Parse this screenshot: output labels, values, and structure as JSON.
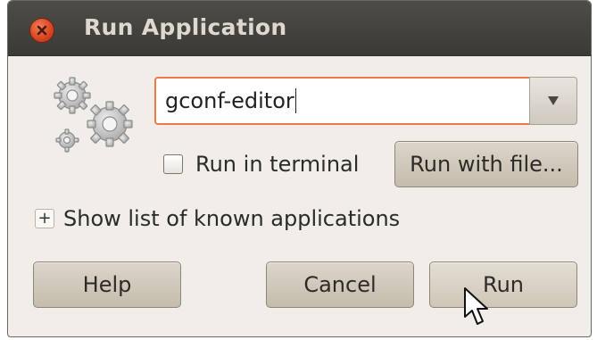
{
  "window": {
    "title": "Run Application",
    "close_icon": "close-icon"
  },
  "app_icon": "gears-icon",
  "command": {
    "value": "gconf-editor",
    "dropdown_icon": "triangle-down-icon"
  },
  "run_in_terminal": {
    "label": "Run in terminal",
    "checked": false
  },
  "buttons": {
    "run_with_file": "Run with file...",
    "help": "Help",
    "cancel": "Cancel",
    "run": "Run"
  },
  "expander": {
    "symbol": "+",
    "label": "Show list of known applications"
  },
  "colors": {
    "titlebar": "#3b3a36",
    "focus_border": "#f07746",
    "close_button": "#d8431f",
    "dialog_bg": "#f1eee9"
  }
}
